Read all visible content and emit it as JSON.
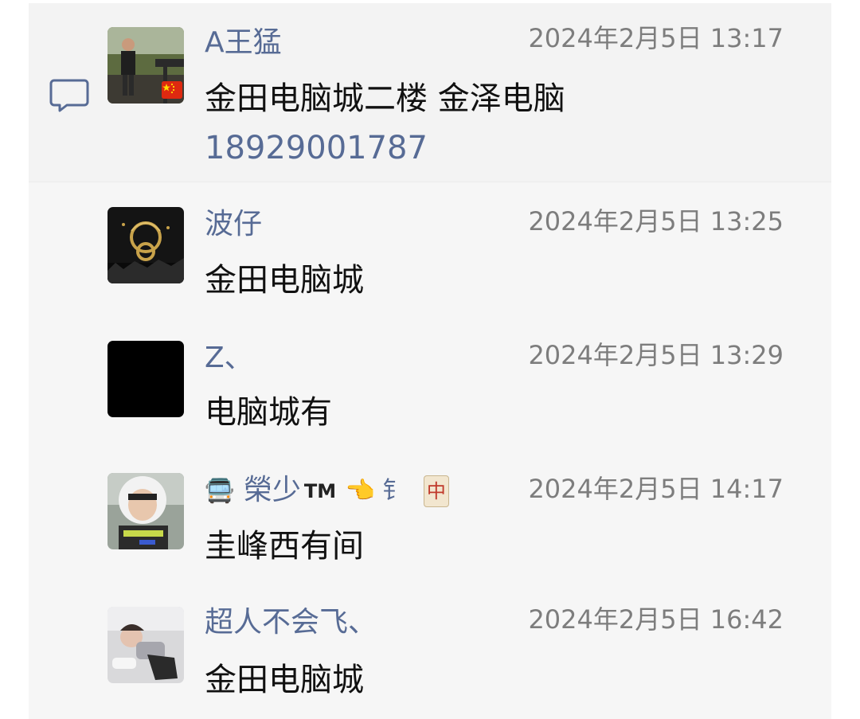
{
  "comments": [
    {
      "author": "A王猛",
      "time": "2024年2月5日 13:17",
      "message": "金田电脑城二楼 金泽电脑",
      "phone": "18929001787",
      "avatar": "person-at-railing-photo"
    },
    {
      "author": "波仔",
      "time": "2024年2月5日 13:25",
      "message": "金田电脑城",
      "avatar": "dark-golden-logo-photo"
    },
    {
      "author": "Z、",
      "time": "2024年2月5日 13:29",
      "message": "电脑城有",
      "avatar": "black-square"
    },
    {
      "author": "榮少",
      "author_prefix": "🚍",
      "author_tm": "TM",
      "author_suffix": "👈 钅",
      "author_tile": "中",
      "time": "2024年2月5日 14:17",
      "message": "圭峰西有间",
      "avatar": "police-motorcyclist-photo"
    },
    {
      "author": "超人不会飞、",
      "time": "2024年2月5日 16:42",
      "message": "金田电脑城",
      "avatar": "child-lying-photo"
    }
  ],
  "colors": {
    "author": "#576b95",
    "time": "#7d7d7d",
    "message": "#111111",
    "panel": "#f6f6f6"
  },
  "icons": {
    "comment": "speech-bubble-icon",
    "flag": "china-flag-icon"
  }
}
